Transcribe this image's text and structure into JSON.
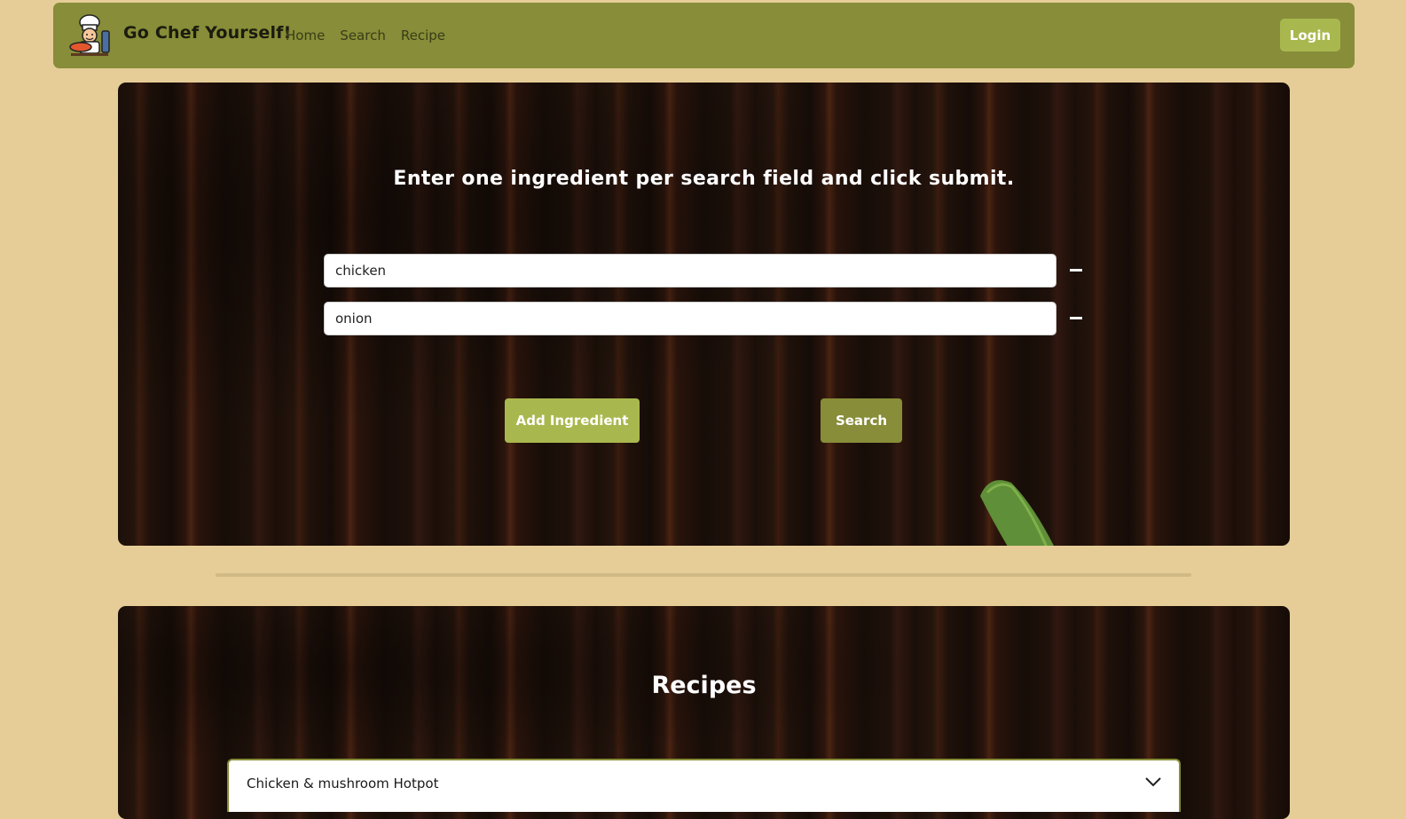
{
  "header": {
    "brand": "Go Chef Yourself!",
    "nav": [
      {
        "label": "Home"
      },
      {
        "label": "Search"
      },
      {
        "label": "Recipe"
      }
    ],
    "login_label": "Login"
  },
  "search": {
    "heading": "Enter one ingredient per search field and click submit.",
    "ingredients": [
      {
        "value": "chicken"
      },
      {
        "value": "onion"
      }
    ],
    "add_label": "Add Ingredient",
    "search_label": "Search",
    "remove_icon": "minus-icon"
  },
  "recipes": {
    "heading": "Recipes",
    "items": [
      {
        "title": "Chicken & mushroom Hotpot",
        "icon": "chevron-down-icon"
      }
    ]
  },
  "colors": {
    "background": "#e6cd98",
    "navbar": "#878d38",
    "accent_light": "#a9b84e",
    "accent_dark": "#878d38"
  }
}
